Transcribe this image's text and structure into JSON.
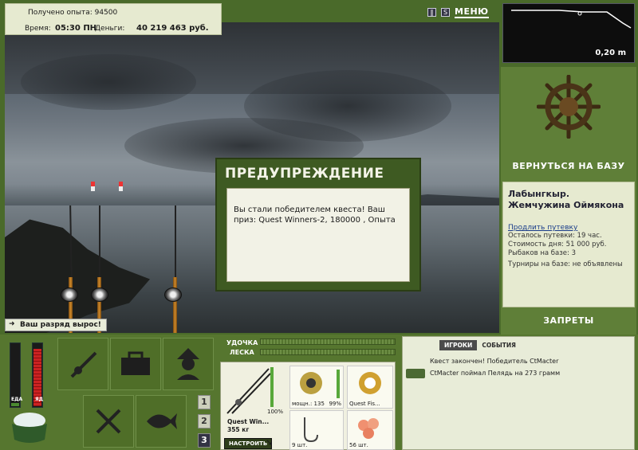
{
  "header": {
    "xp_text": "Получено опыта: 94500",
    "time_label": "Время:",
    "time_value": "05:30 ПН",
    "money_label": "Деньги:",
    "money_value": "40 219 463 руб.",
    "menu_label": "МЕНЮ",
    "pause_icon": "pause-icon",
    "settings_icon": "s-icon"
  },
  "depth": {
    "value": "0,20 m"
  },
  "scene": {
    "rank_note": "Ваш разряд вырос!"
  },
  "dialog": {
    "title": "ПРЕДУПРЕЖДЕНИЕ",
    "message": "Вы стали победителем квеста! Ваш приз: Quest Winners-2, 180000 , Опыта"
  },
  "right_panel": {
    "back_to_base": "ВЕРНУТЬСЯ НА БАЗУ",
    "location_title": "Лабынгкыр. Жемчужина Оймякона",
    "extend_link": "Продлить путевку",
    "lines": [
      "Осталось путевки: 19 час.",
      "Стоимость дня: 51 000 руб.",
      "Рыбаков на базе: 3",
      "Турниры на базе: не объявлены"
    ],
    "bans": "ЗАПРЕТЫ"
  },
  "status": {
    "food_label": "ЕДА",
    "poison_label": "ЯД",
    "food_level": 0.05,
    "poison_level": 0.9
  },
  "pages": [
    "1",
    "2",
    "3"
  ],
  "gear": {
    "rod_label": "УДОЧКА",
    "line_label": "ЛЕСКА",
    "rod_name": "Quest Win...",
    "rod_weight": "355 кг",
    "rod_pct": "100%",
    "reel_power": "мощн.: 135",
    "reel_pct": "99%",
    "line_name": "Quest Fis...",
    "hook_count": "9 шт.",
    "bait_count": "56 шт.",
    "setup_button": "НАСТРОИТЬ"
  },
  "chat": {
    "tabs": [
      "ИГРОКИ",
      "СОБЫТИЯ"
    ],
    "messages": [
      "Квест закончен! Победитель CtMacter",
      "CtMacter поймал Пелядь на 273 грамм"
    ]
  }
}
